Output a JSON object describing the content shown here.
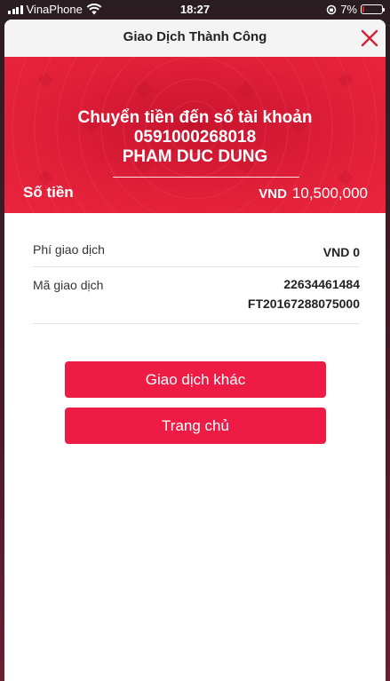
{
  "status_bar": {
    "carrier": "VinaPhone",
    "time": "18:27",
    "battery_percent": "7%",
    "battery_level": 0.07
  },
  "header": {
    "title": "Giao Dịch Thành Công",
    "close_icon": "close-icon"
  },
  "hero": {
    "line1": "Chuyển tiền đến số tài khoản",
    "account_number": "0591000268018",
    "recipient_name": "PHAM DUC DUNG",
    "amount_label": "Số tiền",
    "currency": "VND",
    "amount": "10,500,000"
  },
  "details": {
    "fee_label": "Phí giao dịch",
    "fee_value": "VND 0",
    "txn_label": "Mã giao dịch",
    "txn_value_line1": "22634461484",
    "txn_value_line2": "FT20167288075000"
  },
  "buttons": {
    "other_transaction": "Giao dịch khác",
    "home": "Trang chủ"
  },
  "colors": {
    "hero_red": "#e41c37",
    "button_red": "#ee1c44",
    "close_red": "#d6203a"
  }
}
